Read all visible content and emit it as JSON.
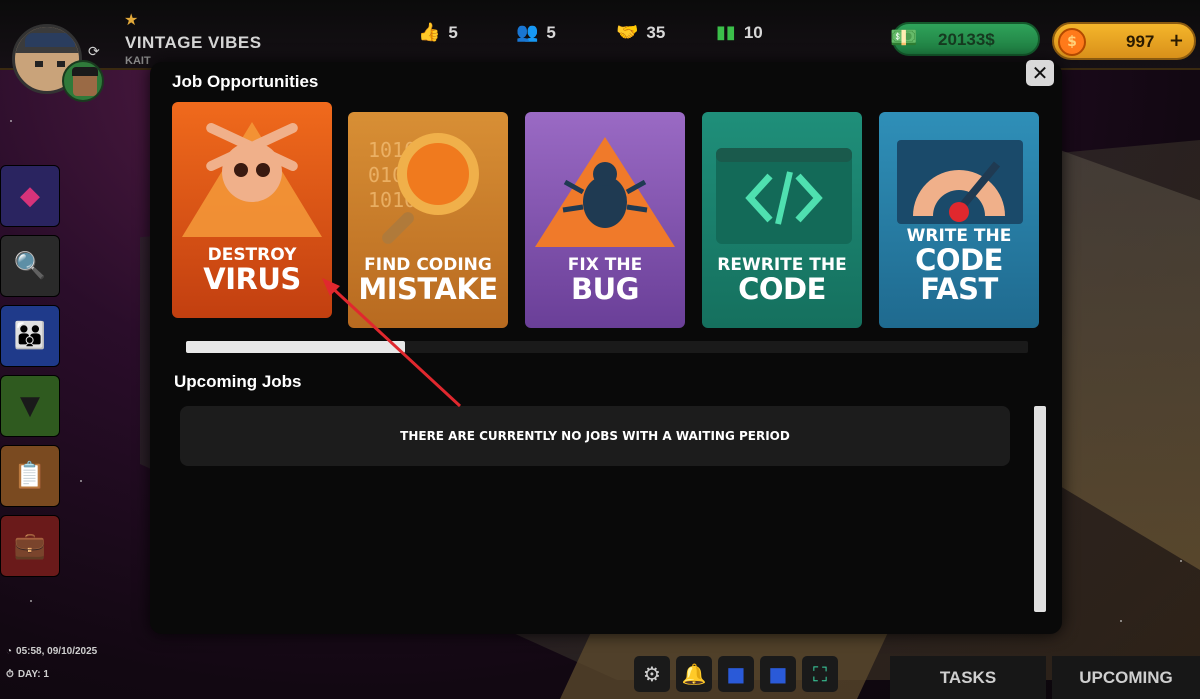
{
  "company": {
    "name": "VINTAGE VIBES",
    "subtitle": "KAIT"
  },
  "stats": {
    "likes": "5",
    "employees": "5",
    "deals": "35",
    "level": "10"
  },
  "currency": {
    "money": "20133$",
    "coins": "997",
    "coins_add": "+"
  },
  "modal": {
    "title": "Job Opportunities",
    "close_label": "✕",
    "cards": [
      {
        "top": "DESTROY",
        "big": "VIRUS",
        "color": "#e25a1c"
      },
      {
        "top": "FIND CODING",
        "big": "MISTAKE",
        "color": "#d58a2a"
      },
      {
        "top": "FIX THE",
        "big": "BUG",
        "color": "#7a4aa8"
      },
      {
        "top": "REWRITE THE",
        "big": "CODE",
        "color": "#1f9a7a"
      },
      {
        "top": "WRITE THE",
        "big": "CODE FAST",
        "color": "#2a7fa8"
      }
    ],
    "carousel_progress": 0.26,
    "upcoming_title": "Upcoming Jobs",
    "empty_message": "THERE ARE CURRENTLY NO JOBS WITH A WAITING PERIOD"
  },
  "status": {
    "clock": "05:58, 09/10/2025",
    "day": "DAY: 1"
  },
  "tabs": {
    "tasks": "TASKS",
    "upcoming": "UPCOMING"
  },
  "colors": {
    "accent_money": "#2fa35a",
    "accent_coin": "#f4b62b",
    "annotation_arrow": "#e0282e"
  }
}
